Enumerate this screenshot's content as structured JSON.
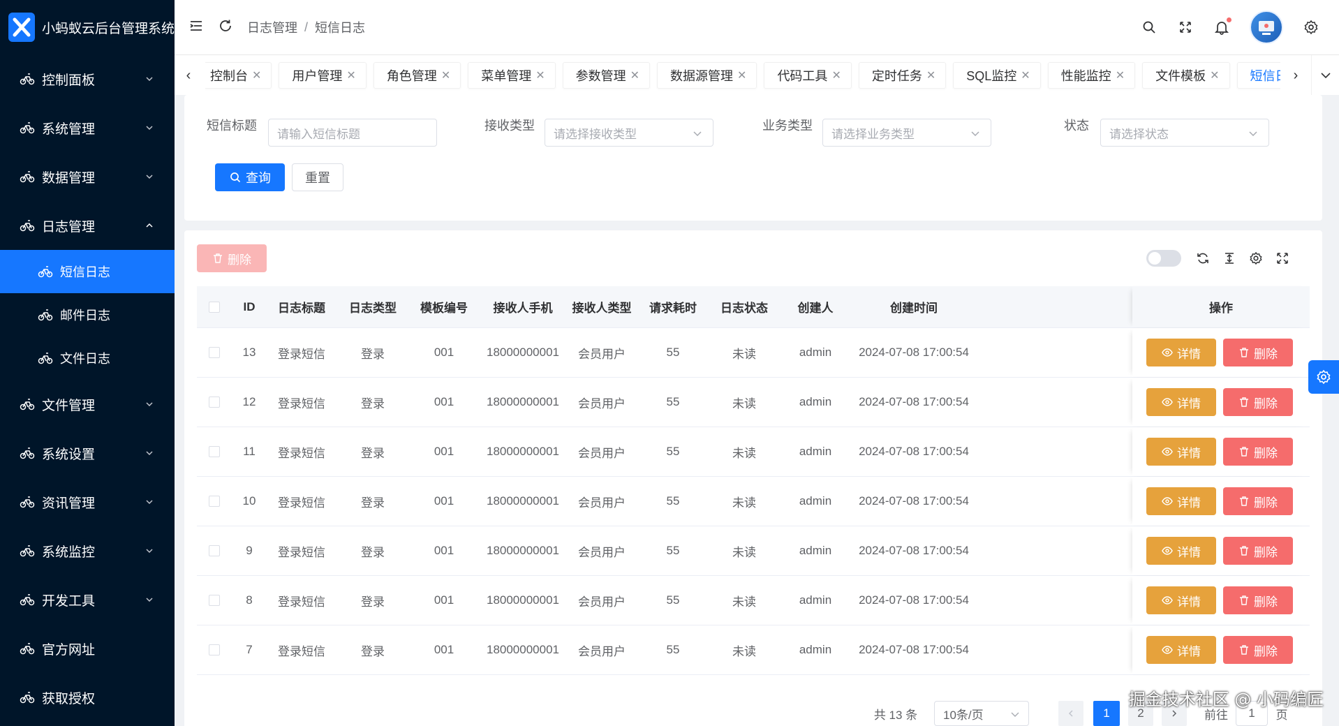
{
  "app": {
    "title": "小蚂蚁云后台管理系统",
    "logo_letter": "X"
  },
  "sidebar": {
    "items": [
      {
        "label": "控制面板"
      },
      {
        "label": "系统管理"
      },
      {
        "label": "数据管理"
      },
      {
        "label": "日志管理",
        "expanded": true
      },
      {
        "label": "文件管理"
      },
      {
        "label": "系统设置"
      },
      {
        "label": "资讯管理"
      },
      {
        "label": "系统监控"
      },
      {
        "label": "开发工具"
      },
      {
        "label": "官方网址"
      },
      {
        "label": "获取授权"
      }
    ],
    "sub_items": [
      {
        "label": "短信日志",
        "active": true
      },
      {
        "label": "邮件日志"
      },
      {
        "label": "文件日志"
      }
    ]
  },
  "header": {
    "breadcrumb": [
      "日志管理",
      "短信日志"
    ],
    "breadcrumb_sep": "/"
  },
  "tabs": [
    {
      "label": "控制台"
    },
    {
      "label": "用户管理"
    },
    {
      "label": "角色管理"
    },
    {
      "label": "菜单管理"
    },
    {
      "label": "参数管理"
    },
    {
      "label": "数据源管理"
    },
    {
      "label": "代码工具"
    },
    {
      "label": "定时任务"
    },
    {
      "label": "SQL监控"
    },
    {
      "label": "性能监控"
    },
    {
      "label": "文件模板"
    },
    {
      "label": "短信日志",
      "active": true
    }
  ],
  "search": {
    "title_label": "短信标题",
    "title_placeholder": "请输入短信标题",
    "receive_type_label": "接收类型",
    "receive_type_placeholder": "请选择接收类型",
    "biz_type_label": "业务类型",
    "biz_type_placeholder": "请选择业务类型",
    "status_label": "状态",
    "status_placeholder": "请选择状态",
    "query_label": "查询",
    "reset_label": "重置"
  },
  "toolbar": {
    "delete_label": "删除"
  },
  "table": {
    "columns": [
      "ID",
      "日志标题",
      "日志类型",
      "模板编号",
      "接收人手机",
      "接收人类型",
      "请求耗时",
      "日志状态",
      "创建人",
      "创建时间",
      "操作"
    ],
    "detail_label": "详情",
    "delete_label": "删除",
    "rows": [
      {
        "id": "13",
        "title": "登录短信",
        "type": "登录",
        "template": "001",
        "phone": "18000000001",
        "receiver_type": "会员用户",
        "cost": "55",
        "status": "未读",
        "creator": "admin",
        "created": "2024-07-08 17:00:54"
      },
      {
        "id": "12",
        "title": "登录短信",
        "type": "登录",
        "template": "001",
        "phone": "18000000001",
        "receiver_type": "会员用户",
        "cost": "55",
        "status": "未读",
        "creator": "admin",
        "created": "2024-07-08 17:00:54"
      },
      {
        "id": "11",
        "title": "登录短信",
        "type": "登录",
        "template": "001",
        "phone": "18000000001",
        "receiver_type": "会员用户",
        "cost": "55",
        "status": "未读",
        "creator": "admin",
        "created": "2024-07-08 17:00:54"
      },
      {
        "id": "10",
        "title": "登录短信",
        "type": "登录",
        "template": "001",
        "phone": "18000000001",
        "receiver_type": "会员用户",
        "cost": "55",
        "status": "未读",
        "creator": "admin",
        "created": "2024-07-08 17:00:54"
      },
      {
        "id": "9",
        "title": "登录短信",
        "type": "登录",
        "template": "001",
        "phone": "18000000001",
        "receiver_type": "会员用户",
        "cost": "55",
        "status": "未读",
        "creator": "admin",
        "created": "2024-07-08 17:00:54"
      },
      {
        "id": "8",
        "title": "登录短信",
        "type": "登录",
        "template": "001",
        "phone": "18000000001",
        "receiver_type": "会员用户",
        "cost": "55",
        "status": "未读",
        "creator": "admin",
        "created": "2024-07-08 17:00:54"
      },
      {
        "id": "7",
        "title": "登录短信",
        "type": "登录",
        "template": "001",
        "phone": "18000000001",
        "receiver_type": "会员用户",
        "cost": "55",
        "status": "未读",
        "creator": "admin",
        "created": "2024-07-08 17:00:54"
      }
    ]
  },
  "pagination": {
    "total_text": "共 13 条",
    "page_size": "10条/页",
    "pages": [
      "1",
      "2"
    ],
    "current": "1",
    "goto_label": "前往",
    "goto_value": "1",
    "page_unit": "页"
  },
  "watermark": "掘金技术社区 @ 小码编匠",
  "colors": {
    "primary": "#1677ff",
    "sidebar": "#001529",
    "warning": "#e6a23c",
    "danger": "#f56c6c"
  }
}
